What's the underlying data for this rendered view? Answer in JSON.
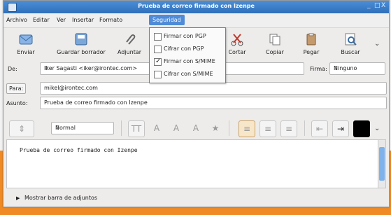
{
  "window": {
    "title": "Prueba de correo firmado con Izenpe",
    "controls": [
      "_",
      "□",
      "X"
    ]
  },
  "menu": {
    "items": [
      "Archivo",
      "Editar",
      "Ver",
      "Insertar",
      "Formato",
      "Seguridad"
    ],
    "active": "Seguridad"
  },
  "toolbar": {
    "buttons": [
      "Enviar",
      "Guardar borrador",
      "Adjuntar",
      "Cortar",
      "Copiar",
      "Pegar",
      "Buscar"
    ]
  },
  "security_menu": {
    "items": [
      {
        "label": "Firmar con PGP",
        "checked": false
      },
      {
        "label": "Cifrar con PGP",
        "checked": false
      },
      {
        "label": "Firmar con S/MIME",
        "checked": true
      },
      {
        "label": "Cifrar con S/MIME",
        "checked": false
      }
    ]
  },
  "from": {
    "label": "De:",
    "value": "Iker Sagasti <iker@irontec.com>",
    "signature_label": "Firma:",
    "signature_value": "Ninguno"
  },
  "to": {
    "label": "Para:",
    "value": "mikel@irontec.com"
  },
  "subject": {
    "label": "Asunto:",
    "value": "Prueba de correo firmado con Izenpe"
  },
  "format": {
    "paragraph_style": "Normal"
  },
  "body": {
    "text": "Prueba de correo firmado con Izenpe"
  },
  "footer": {
    "attachments_label": "Mostrar barra de adjuntos"
  },
  "colors": {
    "accent": "#4f8bd7",
    "background": "#f08a24",
    "window": "#edeceb"
  }
}
